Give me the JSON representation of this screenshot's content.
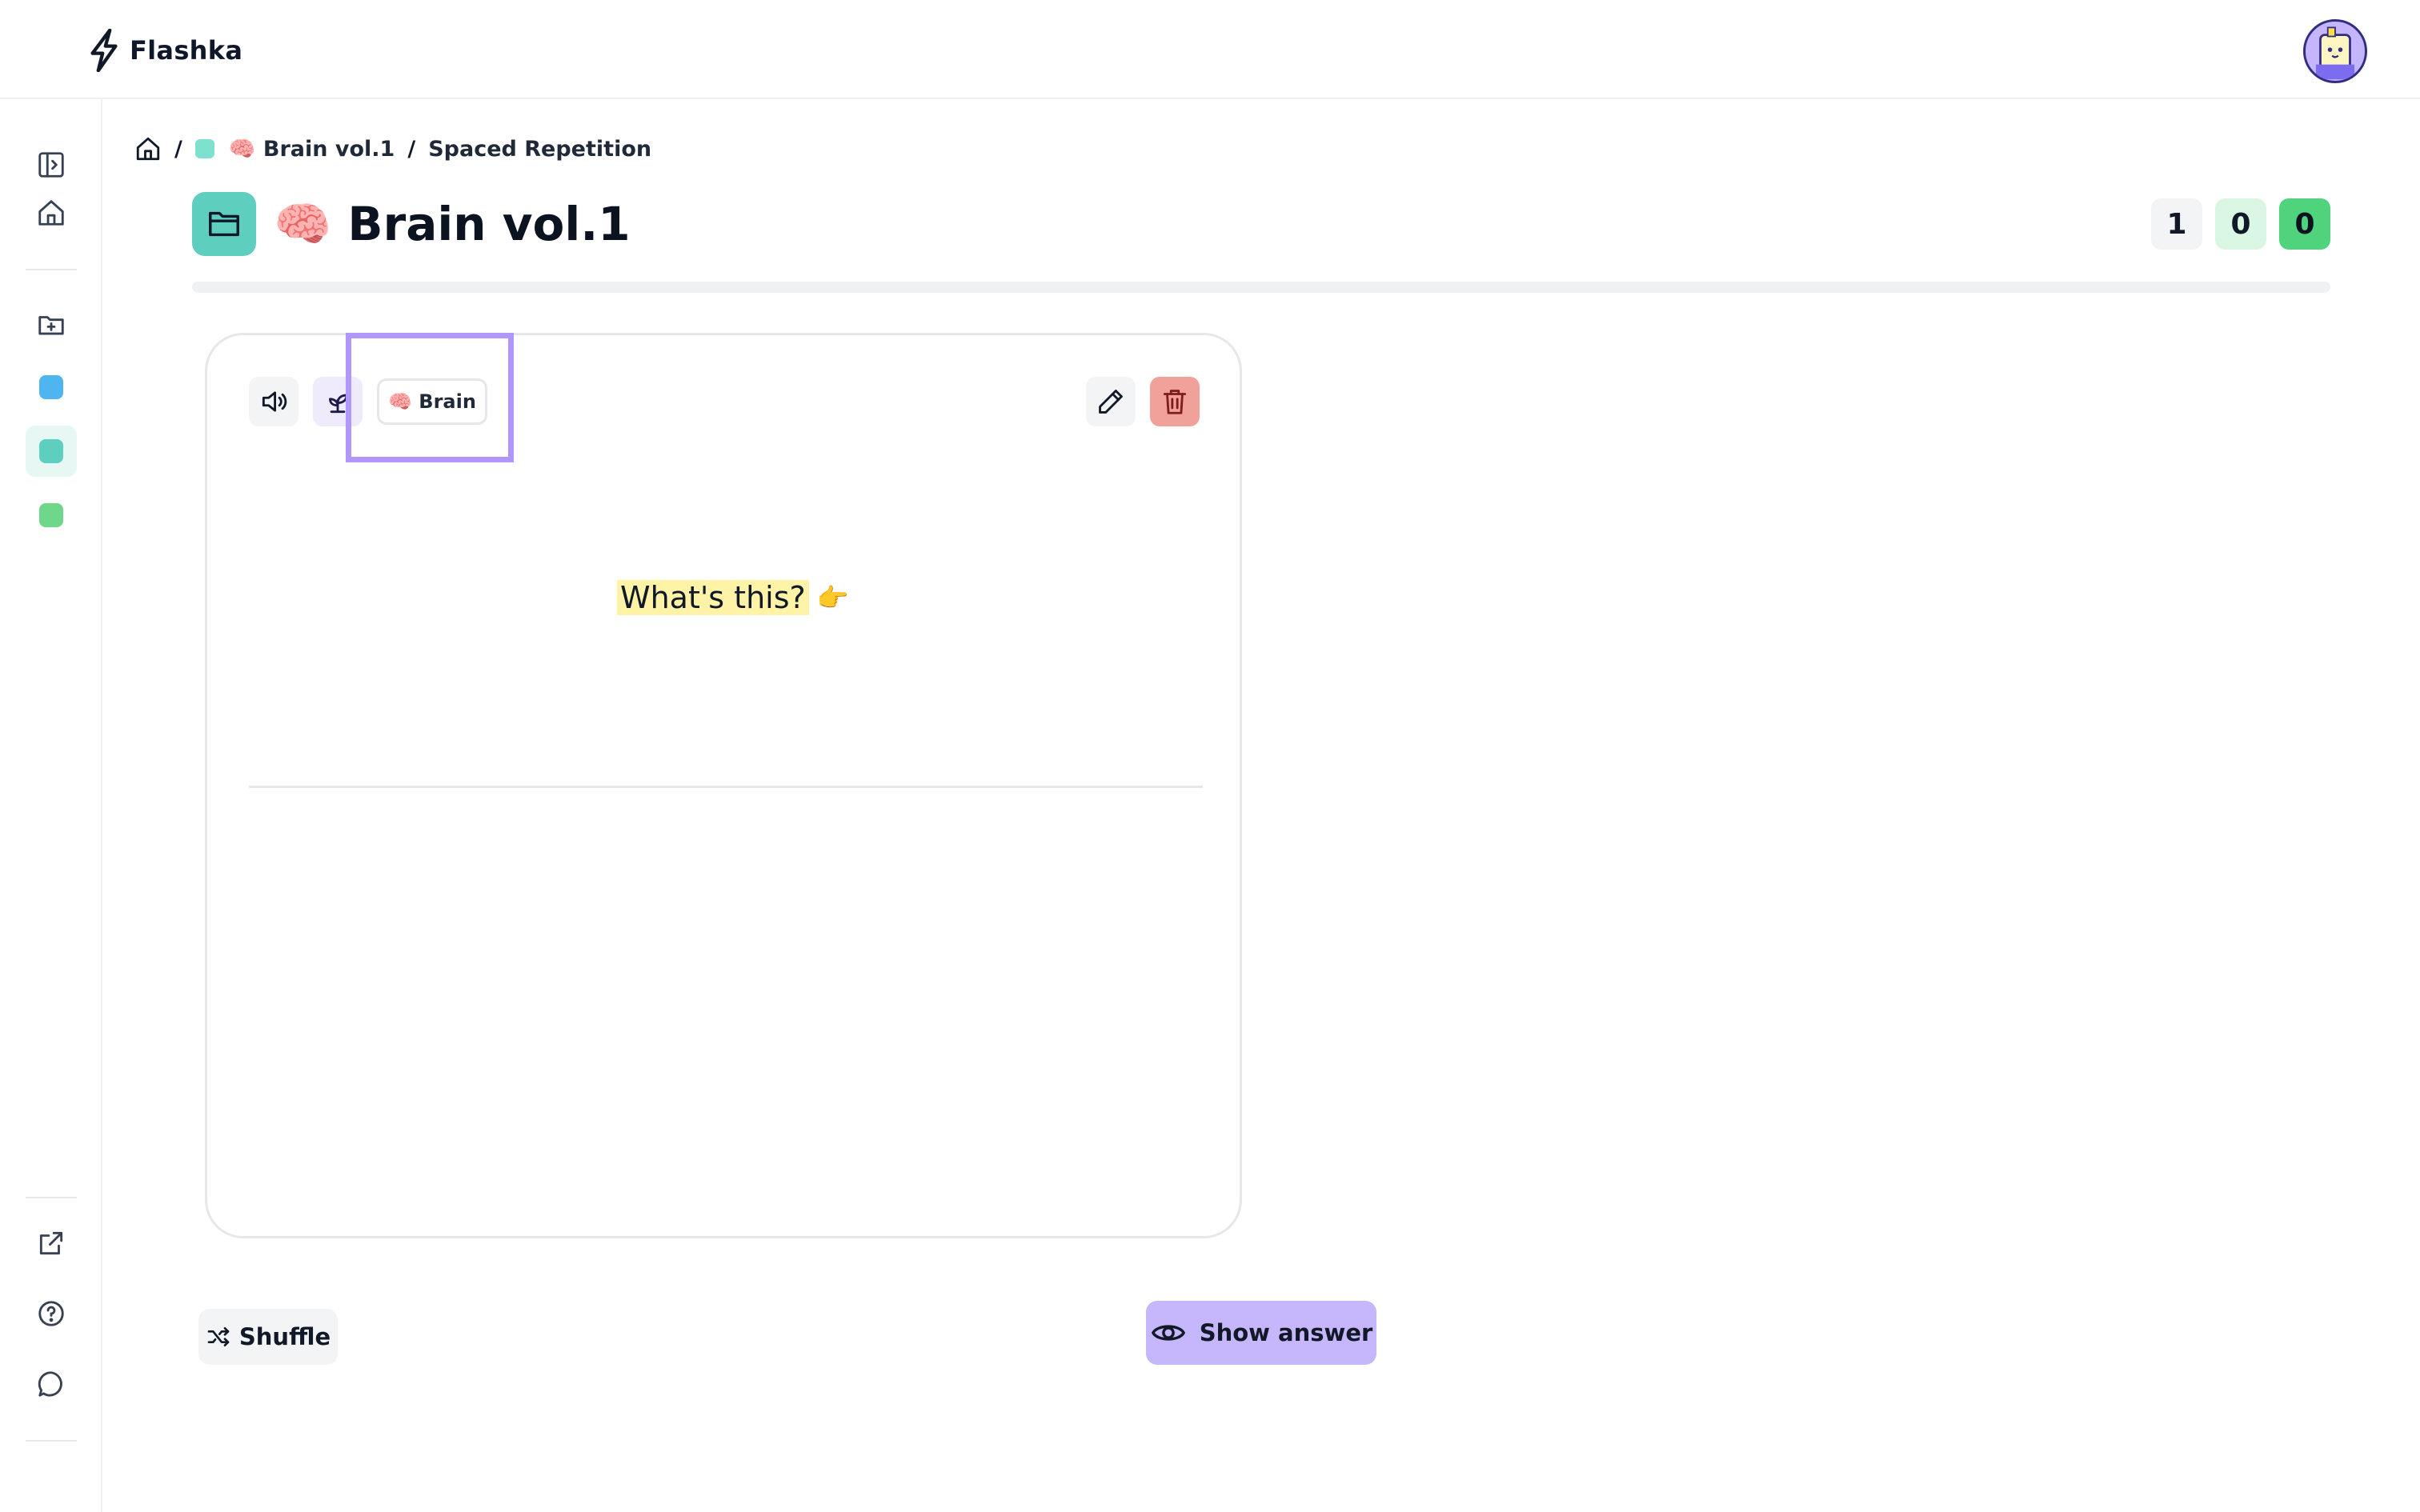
{
  "app": {
    "name": "Flashka"
  },
  "breadcrumb": {
    "separator": "/",
    "deck": "🧠 Brain vol.1",
    "mode": "Spaced Repetition"
  },
  "deck": {
    "title": "🧠 Brain vol.1"
  },
  "counts": [
    {
      "value": "1",
      "color": "#f3f4f6",
      "text_color": "#111827"
    },
    {
      "value": "0",
      "color": "#d9f7e3",
      "text_color": "#111827"
    },
    {
      "value": "0",
      "color": "#4fd37c",
      "text_color": "#0b1220"
    }
  ],
  "progress": {
    "fraction": 0
  },
  "card": {
    "tag": "🧠 Brain",
    "question": "What's this?",
    "question_emoji": "👉"
  },
  "actions": {
    "shuffle_label": "Shuffle",
    "show_answer_label": "Show answer"
  },
  "sidebar": {
    "deck_colors": [
      "#4fb5f0",
      "#5ecfbe",
      "#6ed78a"
    ]
  },
  "colors": {
    "accent": "#c6b6fb",
    "teal": "#5ecfbe",
    "delete": "#f0a19a",
    "highlight": "#fef3a6"
  }
}
